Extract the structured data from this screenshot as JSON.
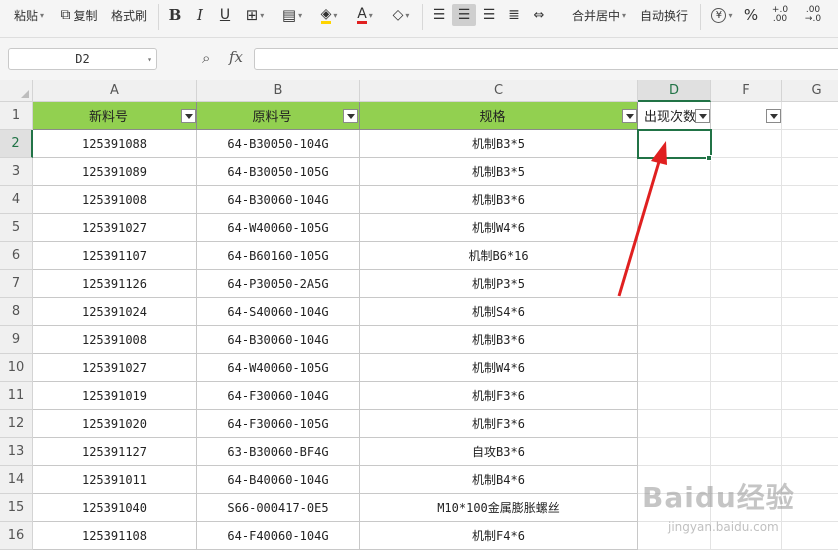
{
  "toolbar": {
    "paste": "粘贴",
    "copy": "复制",
    "format_painter": "格式刷",
    "merge_center": "合并居中",
    "wrap_text": "自动换行",
    "currency_symbol": "¥",
    "percent_symbol": "%",
    "inc_decimal": "+.0\n.00",
    "dec_decimal": ".00\n→.0"
  },
  "formula_bar": {
    "name_box": "D2",
    "fx": "fx",
    "formula": ""
  },
  "columns": [
    "A",
    "B",
    "C",
    "D",
    "F",
    "G"
  ],
  "headers": {
    "A": "新料号",
    "B": "原料号",
    "C": "规格",
    "D": "出现次数"
  },
  "rows": [
    {
      "num": "1"
    },
    {
      "num": "2",
      "a": "125391088",
      "b": "64-B30050-104G",
      "c": "机制B3*5"
    },
    {
      "num": "3",
      "a": "125391089",
      "b": "64-B30050-105G",
      "c": "机制B3*5"
    },
    {
      "num": "4",
      "a": "125391008",
      "b": "64-B30060-104G",
      "c": "机制B3*6"
    },
    {
      "num": "5",
      "a": "125391027",
      "b": "64-W40060-105G",
      "c": "机制W4*6"
    },
    {
      "num": "6",
      "a": "125391107",
      "b": "64-B60160-105G",
      "c": "机制B6*16"
    },
    {
      "num": "7",
      "a": "125391126",
      "b": "64-P30050-2A5G",
      "c": "机制P3*5"
    },
    {
      "num": "8",
      "a": "125391024",
      "b": "64-S40060-104G",
      "c": "机制S4*6"
    },
    {
      "num": "9",
      "a": "125391008",
      "b": "64-B30060-104G",
      "c": "机制B3*6"
    },
    {
      "num": "10",
      "a": "125391027",
      "b": "64-W40060-105G",
      "c": "机制W4*6"
    },
    {
      "num": "11",
      "a": "125391019",
      "b": "64-F30060-104G",
      "c": "机制F3*6"
    },
    {
      "num": "12",
      "a": "125391020",
      "b": "64-F30060-105G",
      "c": "机制F3*6"
    },
    {
      "num": "13",
      "a": "125391127",
      "b": "63-B30060-BF4G",
      "c": "自攻B3*6"
    },
    {
      "num": "14",
      "a": "125391011",
      "b": "64-B40060-104G",
      "c": "机制B4*6"
    },
    {
      "num": "15",
      "a": "125391040",
      "b": "S66-000417-0E5",
      "c": "M10*100金属膨胀螺丝"
    },
    {
      "num": "16",
      "a": "125391108",
      "b": "64-F40060-104G",
      "c": "机制F4*6"
    }
  ],
  "watermark": {
    "logo": "Baidu经验",
    "sub": "jingyan.baidu.com"
  },
  "colors": {
    "header_fill": "#92d050",
    "selection": "#217346",
    "arrow": "#e02020"
  }
}
